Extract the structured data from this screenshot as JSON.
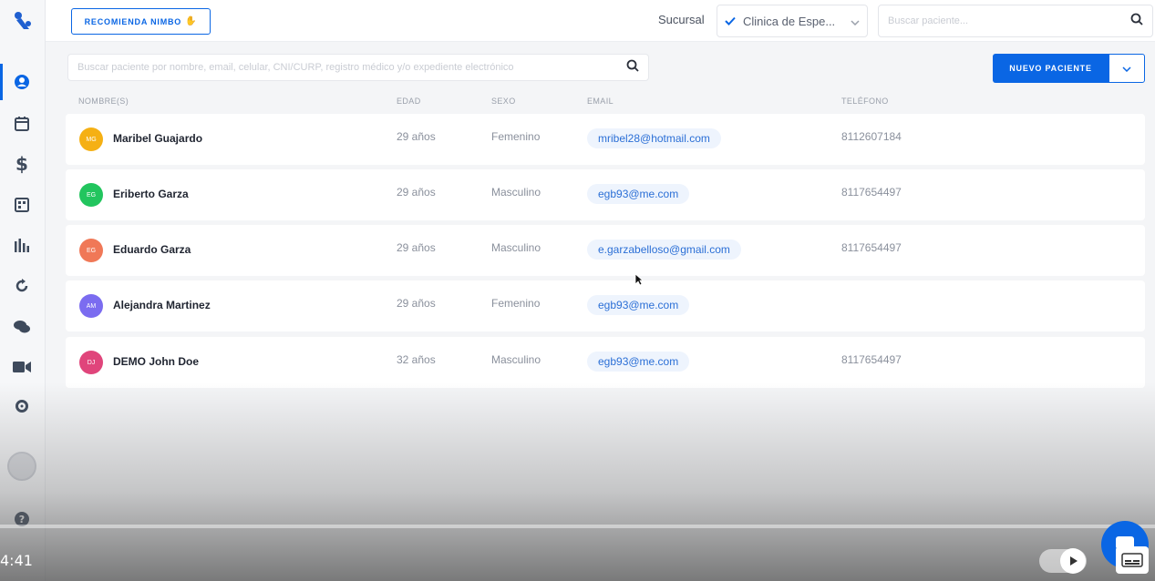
{
  "header": {
    "recommend_label": "RECOMIENDA NIMBO",
    "branch_label": "Sucursal",
    "branch_value": "Clinica de Espe...",
    "search_placeholder": "Buscar paciente..."
  },
  "main": {
    "search_placeholder": "Buscar paciente por nombre, email, celular, CNI/CURP, registro médico y/o expediente electrónico",
    "new_patient_label": "NUEVO PACIENTE"
  },
  "table": {
    "headers": [
      "NOMBRE(S)",
      "EDAD",
      "SEXO",
      "EMAIL",
      "TELÉFONO"
    ],
    "rows": [
      {
        "initials": "MG",
        "name": "Maribel Guajardo",
        "age": "29 años",
        "sex": "Femenino",
        "email": "mribel28@hotmail.com",
        "phone": "8112607184",
        "color": "#f5b014"
      },
      {
        "initials": "EG",
        "name": "Eriberto Garza",
        "age": "29 años",
        "sex": "Masculino",
        "email": "egb93@me.com",
        "phone": "8117654497",
        "color": "#22c55e"
      },
      {
        "initials": "EG",
        "name": "Eduardo Garza",
        "age": "29 años",
        "sex": "Masculino",
        "email": "e.garzabelloso@gmail.com",
        "phone": "8117654497",
        "color": "#f07857"
      },
      {
        "initials": "AM",
        "name": "Alejandra Martinez",
        "age": "29 años",
        "sex": "Femenino",
        "email": "egb93@me.com",
        "phone": "",
        "color": "#7b6cf0"
      },
      {
        "initials": "DJ",
        "name": "DEMO John Doe",
        "age": "32 años",
        "sex": "Masculino",
        "email": "egb93@me.com",
        "phone": "8117654497",
        "color": "#e0457b"
      }
    ]
  },
  "player": {
    "time": "4:41"
  },
  "colors": {
    "accent": "#0a66e4"
  }
}
